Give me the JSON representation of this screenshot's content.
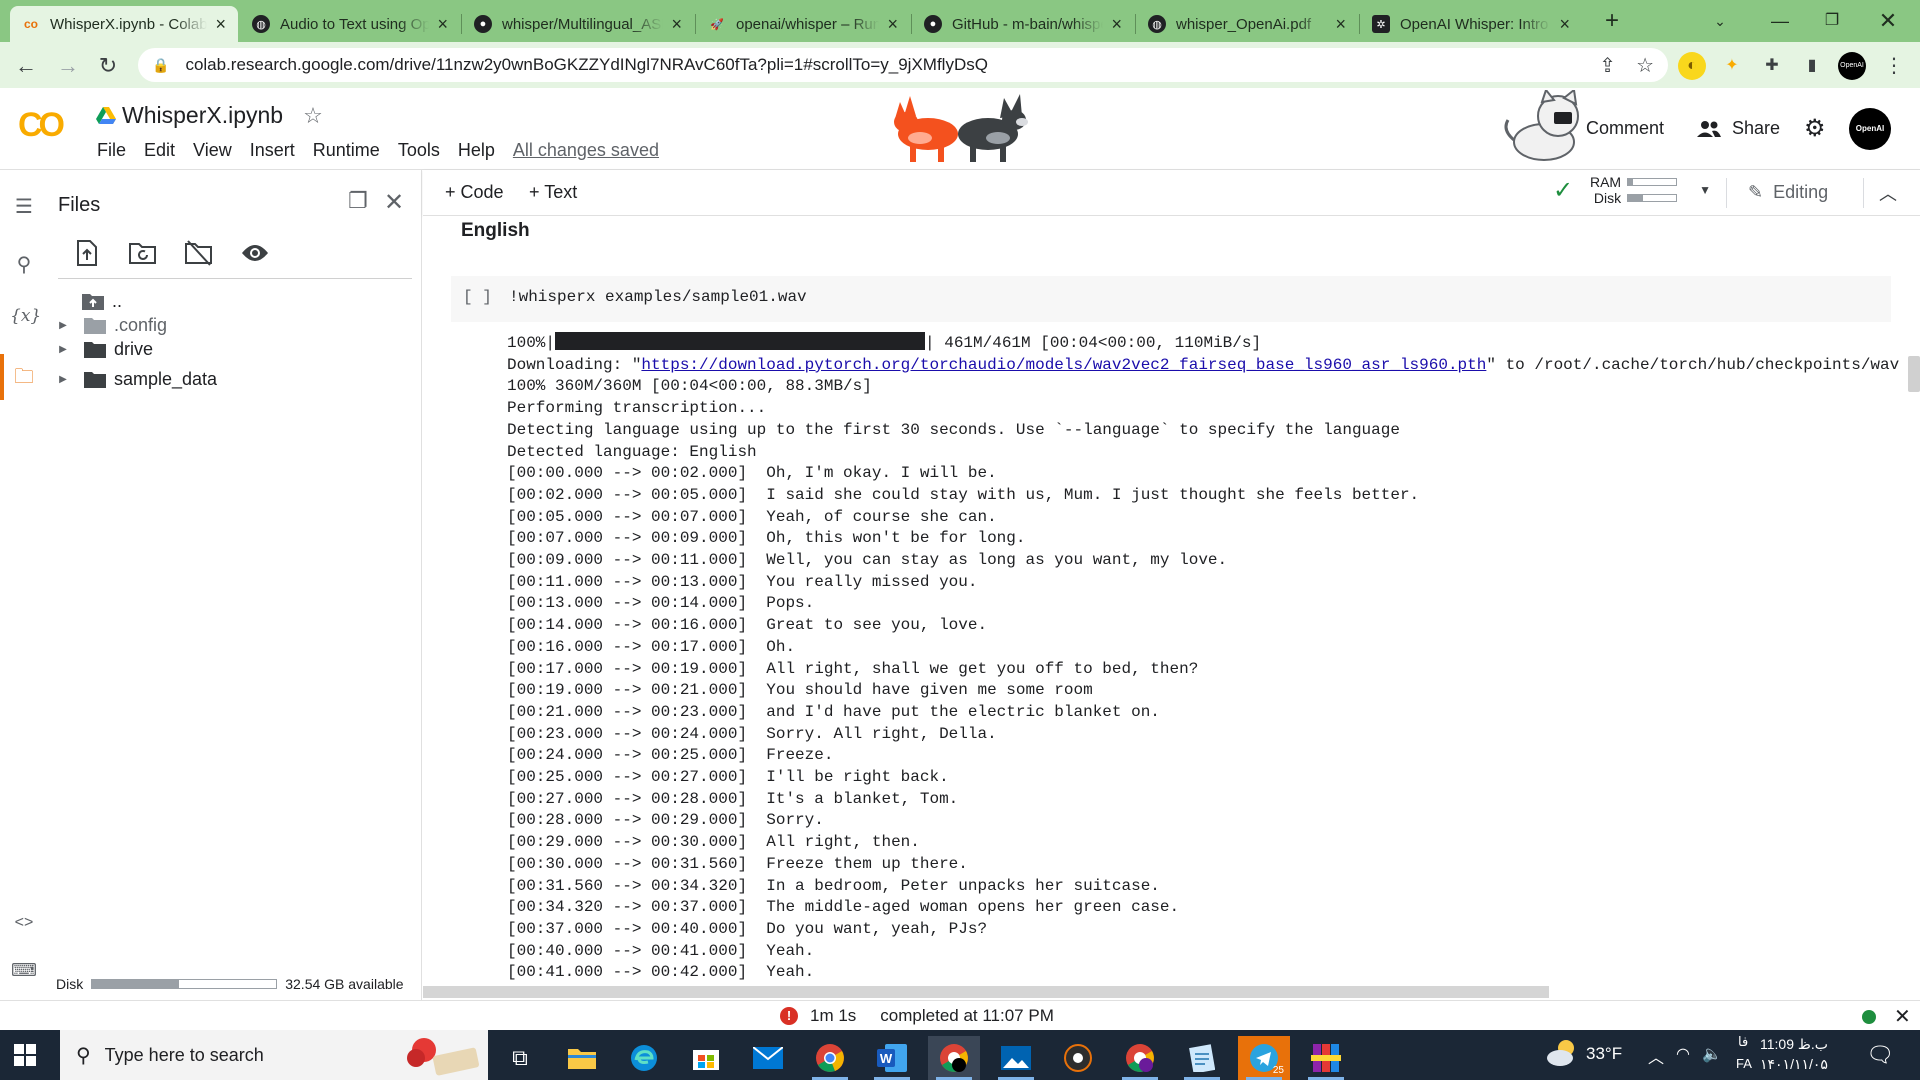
{
  "browser": {
    "tabs": [
      {
        "title": "WhisperX.ipynb - Colab",
        "icon": "colab-icon",
        "active": true
      },
      {
        "title": "Audio to Text using OpenAI",
        "icon": "web-icon"
      },
      {
        "title": "whisper/Multilingual_ASR",
        "icon": "github-icon"
      },
      {
        "title": "openai/whisper – Run",
        "icon": "rocket-icon"
      },
      {
        "title": "GitHub - m-bain/whisperX",
        "icon": "github-icon"
      },
      {
        "title": "whisper_OpenAi.pdf",
        "icon": "web-icon"
      },
      {
        "title": "OpenAI Whisper: Intro",
        "icon": "openai-icon"
      }
    ],
    "url": "colab.research.google.com/drive/11nzw2y0wnBoGKZZYdINgl7NRAvC60fTa?pli=1#scrollTo=y_9jXMflyDsQ"
  },
  "colab": {
    "logo": "CO",
    "notebook_title": "WhisperX.ipynb",
    "menu": [
      "File",
      "Edit",
      "View",
      "Insert",
      "Runtime",
      "Tools",
      "Help"
    ],
    "save_status": "All changes saved",
    "comment_label": "Comment",
    "share_label": "Share",
    "avatar_text": "OpenAI"
  },
  "files_panel": {
    "title": "Files",
    "tree": [
      {
        "name": "..",
        "type": "up"
      },
      {
        "name": ".config",
        "type": "folder",
        "dim": true
      },
      {
        "name": "drive",
        "type": "folder"
      },
      {
        "name": "sample_data",
        "type": "folder"
      }
    ],
    "disk_label": "Disk",
    "disk_available": "32.54 GB available",
    "disk_used_fraction": 0.47
  },
  "nb_toolbar": {
    "add_code": "Code",
    "add_text": "Text",
    "ram_label": "RAM",
    "disk_label": "Disk",
    "ram_fraction": 0.1,
    "disk_fraction": 0.3,
    "editing_label": "Editing"
  },
  "notebook": {
    "section_heading": "English",
    "cell_bracket": "[ ]",
    "cell_code": "!whisperx examples/sample01.wav",
    "progress_prefix": "100%|",
    "progress_suffix": "| 461M/461M [00:04<00:00, 110MiB/s]",
    "download_prefix": "Downloading: \"",
    "download_link": "https://download.pytorch.org/torchaudio/models/wav2vec2_fairseq_base_ls960_asr_ls960.pth",
    "download_suffix": "\" to /root/.cache/torch/hub/checkpoints/wav",
    "output_lines": [
      "100% 360M/360M [00:04<00:00, 88.3MB/s]",
      "Performing transcription...",
      "Detecting language using up to the first 30 seconds. Use `--language` to specify the language",
      "Detected language: English",
      "[00:00.000 --> 00:02.000]  Oh, I'm okay. I will be.",
      "[00:02.000 --> 00:05.000]  I said she could stay with us, Mum. I just thought she feels better.",
      "[00:05.000 --> 00:07.000]  Yeah, of course she can.",
      "[00:07.000 --> 00:09.000]  Oh, this won't be for long.",
      "[00:09.000 --> 00:11.000]  Well, you can stay as long as you want, my love.",
      "[00:11.000 --> 00:13.000]  You really missed you.",
      "[00:13.000 --> 00:14.000]  Pops.",
      "[00:14.000 --> 00:16.000]  Great to see you, love.",
      "[00:16.000 --> 00:17.000]  Oh.",
      "[00:17.000 --> 00:19.000]  All right, shall we get you off to bed, then?",
      "[00:19.000 --> 00:21.000]  You should have given me some room",
      "[00:21.000 --> 00:23.000]  and I'd have put the electric blanket on.",
      "[00:23.000 --> 00:24.000]  Sorry. All right, Della.",
      "[00:24.000 --> 00:25.000]  Freeze.",
      "[00:25.000 --> 00:27.000]  I'll be right back.",
      "[00:27.000 --> 00:28.000]  It's a blanket, Tom.",
      "[00:28.000 --> 00:29.000]  Sorry.",
      "[00:29.000 --> 00:30.000]  All right, then.",
      "[00:30.000 --> 00:31.560]  Freeze them up there.",
      "[00:31.560 --> 00:34.320]  In a bedroom, Peter unpacks her suitcase.",
      "[00:34.320 --> 00:37.000]  The middle-aged woman opens her green case.",
      "[00:37.000 --> 00:40.000]  Do you want, yeah, PJs?",
      "[00:40.000 --> 00:41.000]  Yeah.",
      "[00:41.000 --> 00:42.000]  Yeah."
    ]
  },
  "statusbar": {
    "duration": "1m 1s",
    "completed": "completed at 11:07 PM"
  },
  "taskbar": {
    "search_placeholder": "Type here to search",
    "weather": "33°F",
    "lang": "FA",
    "lang_short": "فا",
    "time": "11:09 ب.ظ",
    "date": "۱۴۰۱/۱۱/۰۵",
    "telegram_badge": "25"
  }
}
